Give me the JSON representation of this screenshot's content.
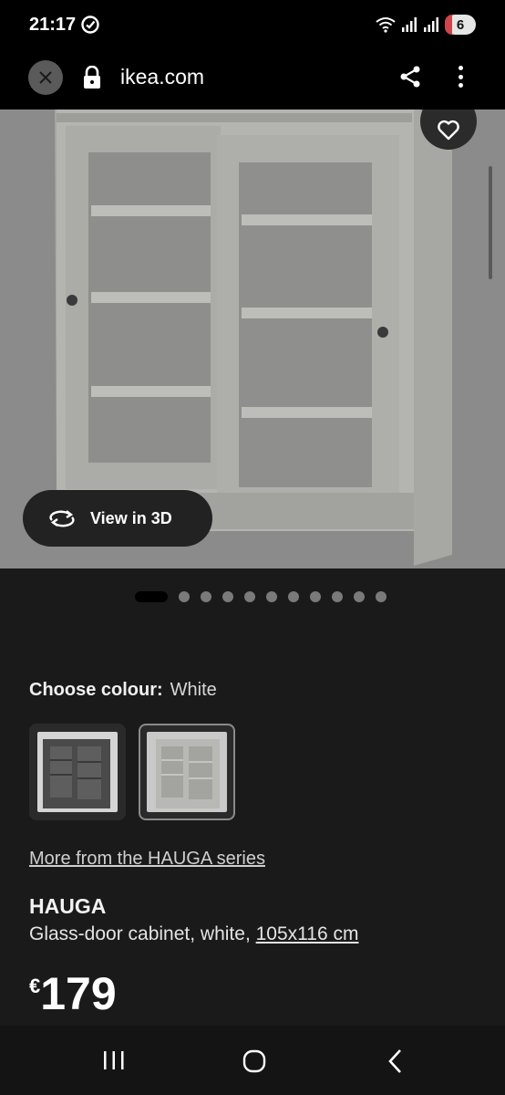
{
  "status_bar": {
    "time": "21:17",
    "battery_level": "6"
  },
  "browser": {
    "url": "ikea.com"
  },
  "gallery": {
    "view_3d_label": "View in 3D",
    "total_images": 11,
    "active_index": 0
  },
  "colour": {
    "label": "Choose colour:",
    "selected": "White"
  },
  "product": {
    "series_link": "More from the HAUGA series",
    "name": "HAUGA",
    "description": "Glass-door cabinet, white, ",
    "size": "105x116 cm",
    "currency": "€",
    "price": "179"
  },
  "colors": {
    "background": "#1a1a1a",
    "image_overlay": "#8b8b8b",
    "button_dark": "#222222"
  }
}
